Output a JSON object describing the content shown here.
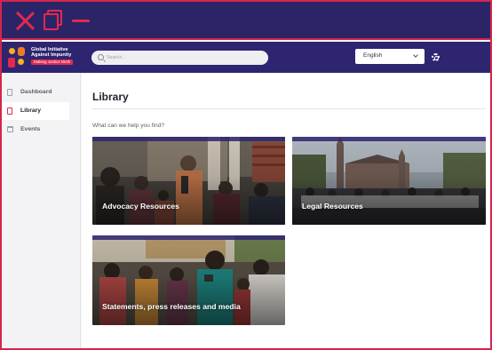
{
  "window": {
    "controls": [
      "close-icon",
      "restore-icon",
      "minimize-icon"
    ],
    "accent_color": "#e2294f",
    "chrome_color": "#2b2467"
  },
  "header": {
    "logo": {
      "name_line1": "Global Initiative",
      "name_line2": "Against Impunity",
      "tagline": "Making Justice Work"
    },
    "search": {
      "placeholder": "Search..."
    },
    "language": {
      "selected": "English"
    },
    "settings_icon": "gear-icon"
  },
  "sidebar": {
    "items": [
      {
        "label": "Dashboard",
        "icon": "grid-icon",
        "active": false
      },
      {
        "label": "Library",
        "icon": "document-icon",
        "active": true
      },
      {
        "label": "Events",
        "icon": "calendar-icon",
        "active": false
      }
    ]
  },
  "main": {
    "title": "Library",
    "subtitle": "What can we help you find?",
    "cards": [
      {
        "title": "Advocacy Resources"
      },
      {
        "title": "Legal Resources"
      },
      {
        "title": "Statements, press releases and media"
      }
    ]
  }
}
